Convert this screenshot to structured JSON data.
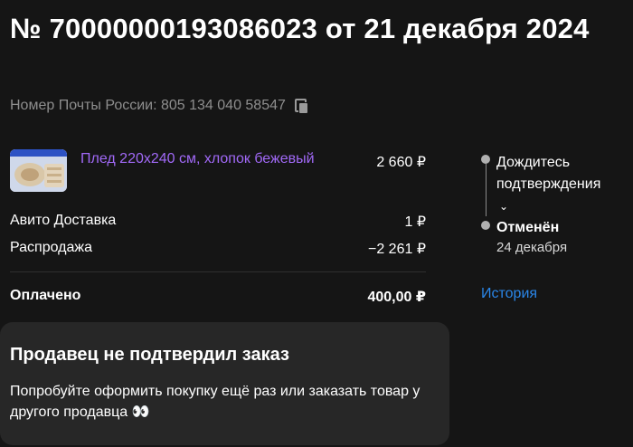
{
  "order": {
    "title": "№ 70000000193086023 от 21 декабря 2024",
    "tracking": "Номер Почты России: 805 134 040 58547"
  },
  "product": {
    "name": "Плед 220x240 см, хлопок бежевый",
    "price": "2 660 ₽",
    "thumb_color": "#cfd6e6",
    "name_color": "#a169f7"
  },
  "lines": [
    {
      "label": "Авито Доставка",
      "value": "1 ₽"
    },
    {
      "label": "Распродажа",
      "value": "−2 261 ₽"
    }
  ],
  "total": {
    "label": "Оплачено",
    "value": "400,00 ₽"
  },
  "timeline": {
    "steps": [
      {
        "label": "Дождитесь подтверждения",
        "icon": "chevron-down-icon",
        "dot_color": "#b0b0b0"
      },
      {
        "label": "Отменён",
        "date": "24 декабря",
        "dot_color": "#b0b0b0"
      }
    ],
    "history_link": "История",
    "link_color": "#2a86e8"
  },
  "notice": {
    "title": "Продавец не подтвердил заказ",
    "text": "Попробуйте оформить покупку ещё раз или заказать товар у другого продавца",
    "emoji": "👀"
  }
}
